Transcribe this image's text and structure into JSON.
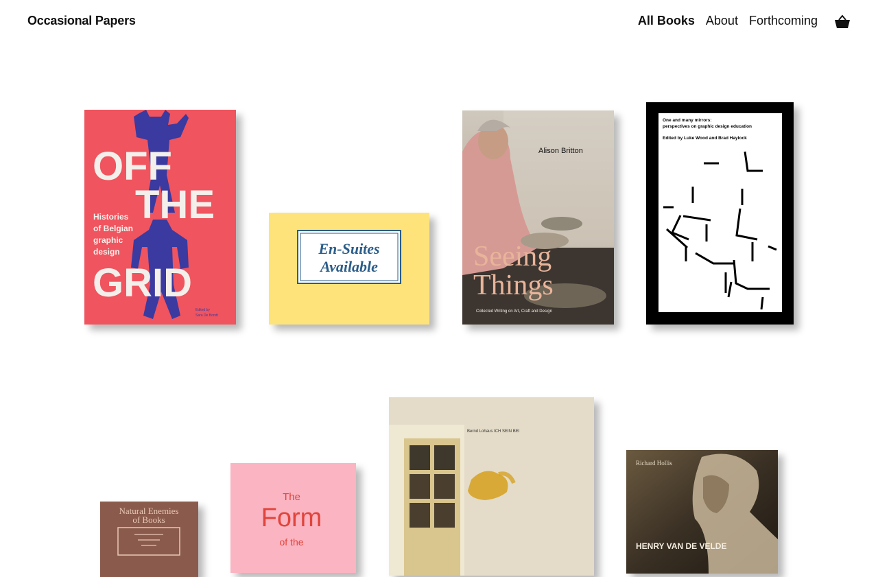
{
  "site": {
    "brand": "Occasional Papers"
  },
  "nav": {
    "items": [
      "All Books",
      "About",
      "Forthcoming"
    ],
    "active_index": 0,
    "cart_icon": "basket-icon"
  },
  "books": {
    "off_the_grid": {
      "title_line1": "OFF",
      "title_line2": "THE",
      "title_line3": "GRID",
      "subtitle": [
        "Histories",
        "of Belgian",
        "graphic",
        "design"
      ],
      "editor": [
        "Edited by",
        "Sara De Bondt"
      ],
      "colors": {
        "background": "#f0545e",
        "figure": "#3a3aa0",
        "letters": "#f3f0ec"
      }
    },
    "en_suites": {
      "title_line1": "En-Suites",
      "title_line2": "Available",
      "colors": {
        "background": "#fde37a",
        "label": "#2b5d8a"
      }
    },
    "seeing_things": {
      "author": "Alison Britton",
      "title_line1": "Seeing",
      "title_line2": "Things",
      "subtitle": "Collected Writing on Art, Craft and Design",
      "colors": {
        "title": "#e8b49a"
      }
    },
    "one_and_many": {
      "title_line1": "One and many mirrors:",
      "title_line2": "perspectives on graphic design education",
      "editors": "Edited by Luke Wood and Brad Haylock"
    },
    "natural_enemies": {
      "title_line1": "Natural Enemies",
      "title_line2": "of Books",
      "colors": {
        "background": "#8a5b4c",
        "letters": "#e9c7b7"
      }
    },
    "the_form": {
      "title_line1": "The",
      "title_line2": "Form",
      "title_line3": "of the",
      "colors": {
        "background": "#fbb4c2",
        "letters": "#e0443a"
      }
    },
    "bernd_lohaus": {
      "header": "Bernd Lohaus    ICH SEIN BEI"
    },
    "van_de_velde": {
      "author": "Richard Hollis",
      "title": "HENRY VAN DE VELDE"
    }
  }
}
